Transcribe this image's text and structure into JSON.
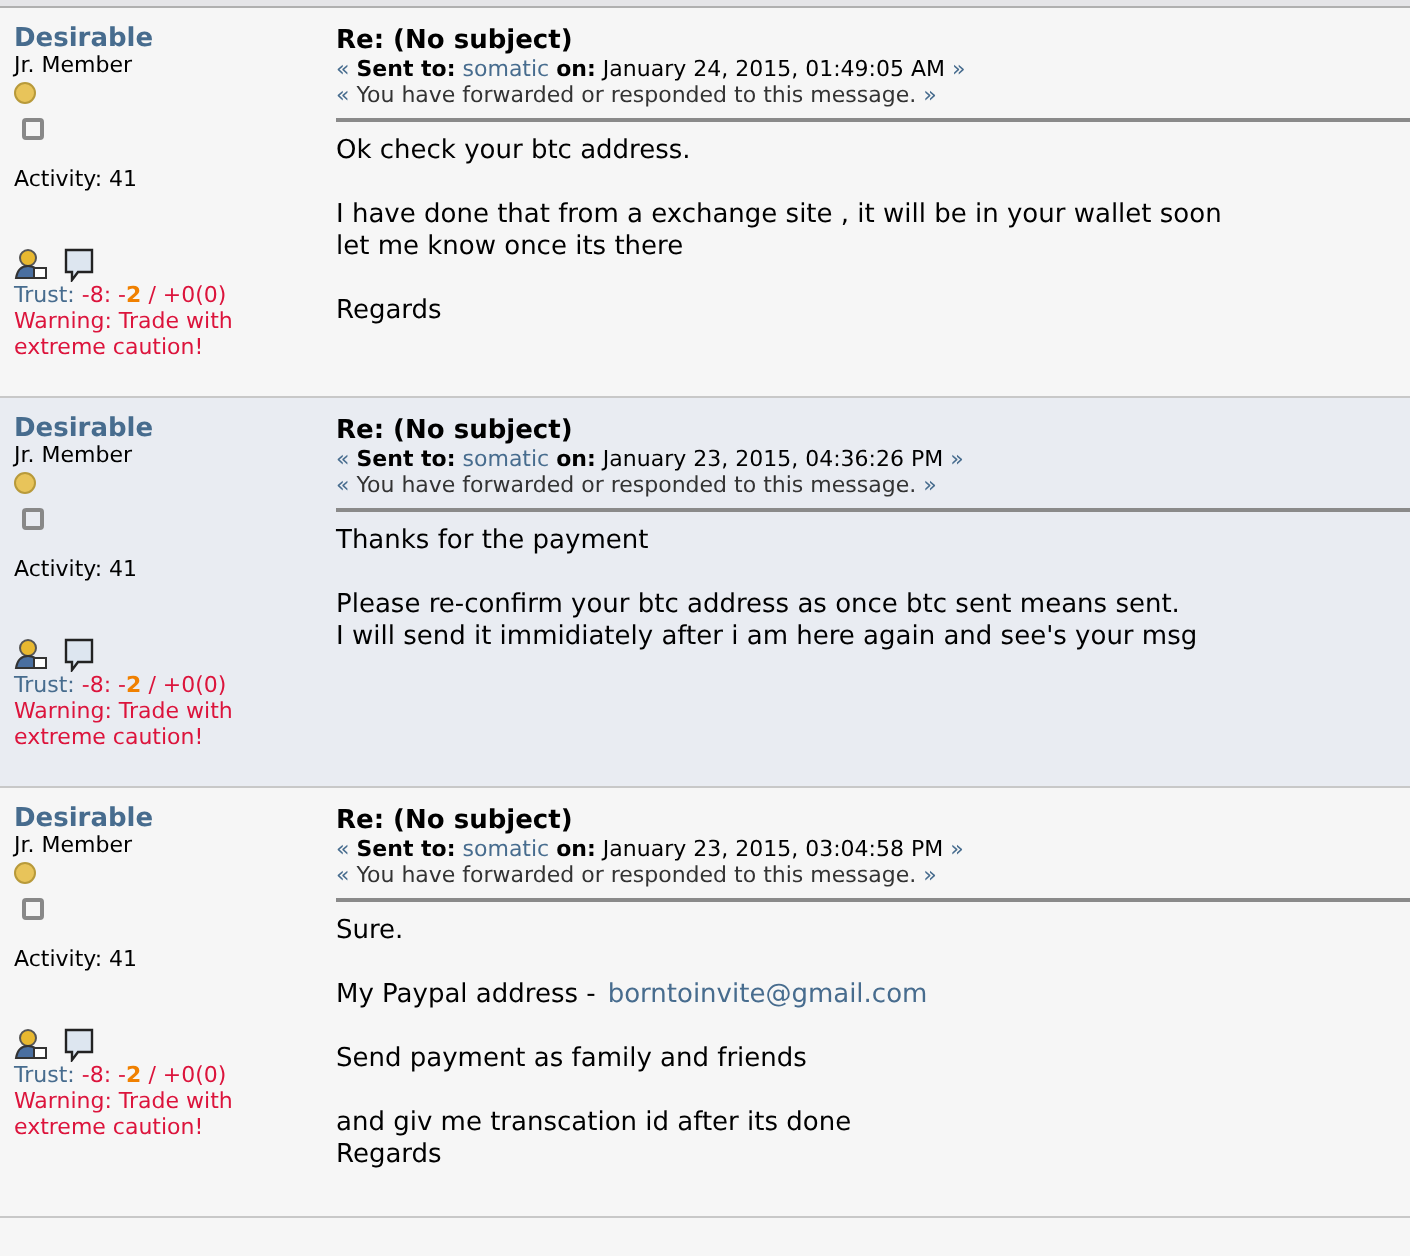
{
  "messages": [
    {
      "author": {
        "name": "Desirable",
        "rank": "Jr. Member",
        "activity": "Activity: 41",
        "trust": {
          "label": "Trust:",
          "score": "-8:",
          "recent": "-**2**",
          "rest": "/ +0(0)"
        },
        "warning": "Warning: Trade with extreme caution!"
      },
      "shaded": false,
      "subject": "Re: (No subject)",
      "quotes": [
        "«",
        "»",
        "«",
        "»"
      ],
      "sent_label": "Sent to:",
      "recipient": "somatic",
      "on_label": "on:",
      "date": "January 24, 2015, 01:49:05 AM",
      "status": "You have forwarded or responded to this message.",
      "paragraphs": [
        {
          "lines": [
            "Ok check your btc address."
          ]
        },
        {
          "lines": [
            "I have done that from a exchange site , it will be in your wallet soon",
            "let me know once its there"
          ]
        },
        {
          "lines": [
            "Regards"
          ]
        }
      ]
    },
    {
      "author": {
        "name": "Desirable",
        "rank": "Jr. Member",
        "activity": "Activity: 41",
        "trust": {
          "label": "Trust:",
          "score": "-8:",
          "recent": "-**2**",
          "rest": "/ +0(0)"
        },
        "warning": "Warning: Trade with extreme caution!"
      },
      "shaded": true,
      "subject": "Re: (No subject)",
      "quotes": [
        "«",
        "»",
        "«",
        "»"
      ],
      "sent_label": "Sent to:",
      "recipient": "somatic",
      "on_label": "on:",
      "date": "January 23, 2015, 04:36:26 PM",
      "status": "You have forwarded or responded to this message.",
      "paragraphs": [
        {
          "lines": [
            "Thanks for the payment"
          ]
        },
        {
          "lines": [
            "Please re-confirm your btc address as once btc sent means sent.",
            "I will send it immidiately after i am here again and see's your msg"
          ]
        }
      ]
    },
    {
      "author": {
        "name": "Desirable",
        "rank": "Jr. Member",
        "activity": "Activity: 41",
        "trust": {
          "label": "Trust:",
          "score": "-8:",
          "recent": "-**2**",
          "rest": "/ +0(0)"
        },
        "warning": "Warning: Trade with extreme caution!"
      },
      "shaded": false,
      "subject": "Re: (No subject)",
      "quotes": [
        "«",
        "»",
        "«",
        "»"
      ],
      "sent_label": "Sent to:",
      "recipient": "somatic",
      "on_label": "on:",
      "date": "January 23, 2015, 03:04:58 PM",
      "status": "You have forwarded or responded to this message.",
      "paragraphs": [
        {
          "lines": [
            "Sure."
          ]
        },
        {
          "lines": [
            "My Paypal address -"
          ],
          "link": "borntoinvite@gmail.com"
        },
        {
          "lines": [
            "Send payment as family and friends"
          ]
        },
        {
          "lines": [
            "and giv me transcation id after its done",
            "Regards"
          ]
        }
      ]
    }
  ]
}
